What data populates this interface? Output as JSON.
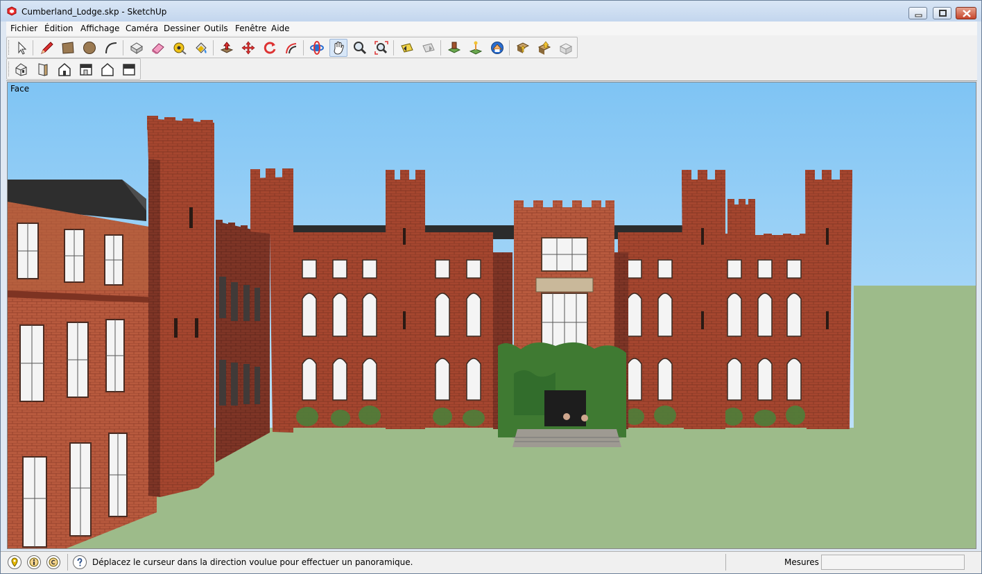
{
  "window": {
    "title": "Cumberland_Lodge.skp - SketchUp",
    "icon": "sketchup-logo-icon",
    "controls": [
      "minimize-icon",
      "maximize-icon",
      "close-icon"
    ]
  },
  "menu": {
    "items": [
      {
        "label": "Fichier"
      },
      {
        "label": "Édition"
      },
      {
        "label": "Affichage"
      },
      {
        "label": "Caméra"
      },
      {
        "label": "Dessiner"
      },
      {
        "label": "Outils"
      },
      {
        "label": "Fenêtre"
      },
      {
        "label": "Aide"
      }
    ]
  },
  "toolbar": {
    "row1": [
      {
        "icon": "select-arrow-icon"
      },
      {
        "icon": "pencil-line-icon"
      },
      {
        "icon": "rectangle-icon"
      },
      {
        "icon": "circle-icon"
      },
      {
        "icon": "arc-icon"
      },
      {
        "icon": "make-component-icon"
      },
      {
        "icon": "eraser-icon"
      },
      {
        "icon": "tape-measure-icon"
      },
      {
        "icon": "paint-bucket-icon"
      },
      {
        "icon": "push-pull-icon"
      },
      {
        "icon": "move-icon"
      },
      {
        "icon": "rotate-icon"
      },
      {
        "icon": "offset-icon"
      },
      {
        "icon": "orbit-icon"
      },
      {
        "icon": "pan-hand-icon",
        "active": true
      },
      {
        "icon": "zoom-icon"
      },
      {
        "icon": "zoom-extents-icon"
      },
      {
        "icon": "previous-view-icon"
      },
      {
        "icon": "next-view-icon"
      },
      {
        "icon": "add-location-icon"
      },
      {
        "icon": "toggle-terrain-icon"
      },
      {
        "icon": "photo-textures-icon"
      },
      {
        "icon": "get-models-icon"
      },
      {
        "icon": "share-model-icon"
      },
      {
        "icon": "extension-warehouse-icon"
      }
    ],
    "row2": [
      {
        "icon": "iso-view-icon"
      },
      {
        "icon": "top-view-icon"
      },
      {
        "icon": "front-view-icon"
      },
      {
        "icon": "right-view-icon"
      },
      {
        "icon": "back-view-icon"
      },
      {
        "icon": "left-view-icon"
      }
    ]
  },
  "viewport": {
    "tool_hint": "Face",
    "sky_color": "#7fc4f4",
    "ground_color": "#9dbb8a",
    "brick_color": "#a5462f"
  },
  "status": {
    "icons": [
      "geo-location-icon",
      "credits-icon",
      "copyright-icon"
    ],
    "help_icon": "question-help-icon",
    "message": "Déplacez le curseur dans la direction voulue pour effectuer un panoramique.",
    "measures_label": "Mesures",
    "measures_value": ""
  }
}
